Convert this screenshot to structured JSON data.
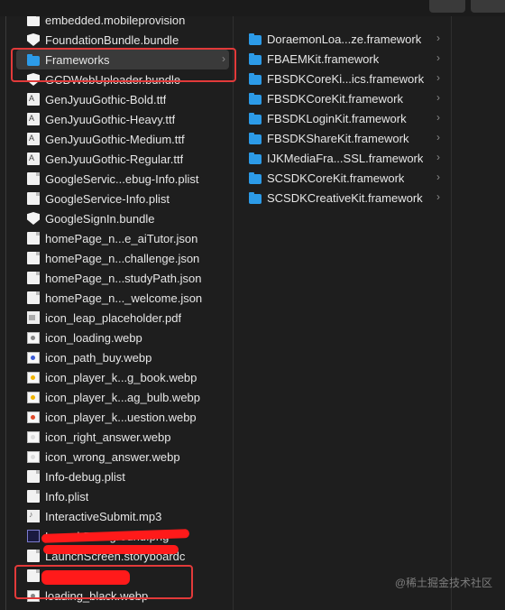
{
  "left_column": {
    "items": [
      {
        "label": "embedded.mobileprovision",
        "icon": "document-icon"
      },
      {
        "label": "FoundationBundle.bundle",
        "icon": "bundle-icon"
      },
      {
        "label": "Frameworks",
        "icon": "folder-icon",
        "selected": true,
        "chevron": "›"
      },
      {
        "label": "GCDWebUploader.bundle",
        "icon": "bundle-icon"
      },
      {
        "label": "GenJyuuGothic-Bold.ttf",
        "icon": "font-file-icon"
      },
      {
        "label": "GenJyuuGothic-Heavy.ttf",
        "icon": "font-file-icon"
      },
      {
        "label": "GenJyuuGothic-Medium.ttf",
        "icon": "font-file-icon"
      },
      {
        "label": "GenJyuuGothic-Regular.ttf",
        "icon": "font-file-icon"
      },
      {
        "label": "GoogleServic...ebug-Info.plist",
        "icon": "document-icon"
      },
      {
        "label": "GoogleService-Info.plist",
        "icon": "document-icon"
      },
      {
        "label": "GoogleSignIn.bundle",
        "icon": "bundle-icon"
      },
      {
        "label": "homePage_n...e_aiTutor.json",
        "icon": "document-icon"
      },
      {
        "label": "homePage_n...challenge.json",
        "icon": "document-icon"
      },
      {
        "label": "homePage_n...studyPath.json",
        "icon": "document-icon"
      },
      {
        "label": "homePage_n..._welcome.json",
        "icon": "document-icon"
      },
      {
        "label": "icon_leap_placeholder.pdf",
        "icon": "pdf-file-icon"
      },
      {
        "label": "icon_loading.webp",
        "icon": "image-file-icon",
        "dot": "#888888"
      },
      {
        "label": "icon_path_buy.webp",
        "icon": "image-file-icon",
        "dot": "#3b5bd6"
      },
      {
        "label": "icon_player_k...g_book.webp",
        "icon": "image-file-icon",
        "dot": "#f0b400"
      },
      {
        "label": "icon_player_k...ag_bulb.webp",
        "icon": "image-file-icon",
        "dot": "#f0b400"
      },
      {
        "label": "icon_player_k...uestion.webp",
        "icon": "image-file-icon",
        "dot": "#e04a2a"
      },
      {
        "label": "icon_right_answer.webp",
        "icon": "image-file-icon",
        "dot": "#dddddd"
      },
      {
        "label": "icon_wrong_answer.webp",
        "icon": "image-file-icon",
        "dot": "#dddddd"
      },
      {
        "label": "Info-debug.plist",
        "icon": "document-icon"
      },
      {
        "label": "Info.plist",
        "icon": "document-icon"
      },
      {
        "label": "InteractiveSubmit.mp3",
        "icon": "audio-file-icon"
      },
      {
        "label": "LaunchBackground.png",
        "icon": "png-file-icon"
      },
      {
        "label": "LaunchScreen.storyboardc",
        "icon": "document-icon"
      },
      {
        "label": "",
        "icon": "app-icon"
      },
      {
        "label": "loading_black.webp",
        "icon": "image-file-icon",
        "dot": "#888888"
      }
    ]
  },
  "frameworks_column": {
    "chevron": "›",
    "items": [
      {
        "label": "DoraemonLoa...ze.framework"
      },
      {
        "label": "FBAEMKit.framework"
      },
      {
        "label": "FBSDKCoreKi...ics.framework"
      },
      {
        "label": "FBSDKCoreKit.framework"
      },
      {
        "label": "FBSDKLoginKit.framework"
      },
      {
        "label": "FBSDKShareKit.framework"
      },
      {
        "label": "IJKMediaFra...SSL.framework"
      },
      {
        "label": "SCSDKCoreKit.framework"
      },
      {
        "label": "SCSDKCreativeKit.framework"
      }
    ]
  },
  "watermark": "@稀土掘金技术社区"
}
